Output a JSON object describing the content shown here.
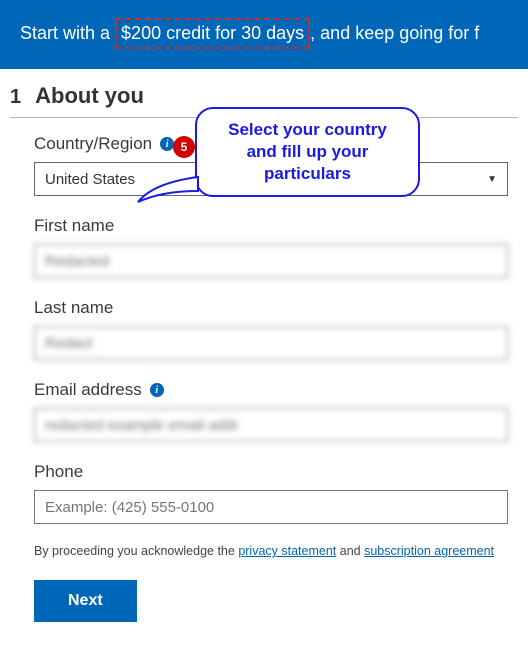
{
  "banner": {
    "prefix": "Start with a ",
    "highlight": "$200 credit for 30 days",
    "suffix": ", and keep going for f"
  },
  "step": {
    "number": "1",
    "title": "About you"
  },
  "annotation": {
    "badge": "5",
    "text": "Select your country and fill up your particulars"
  },
  "form": {
    "country": {
      "label": "Country/Region",
      "value": "United States"
    },
    "first_name": {
      "label": "First name",
      "value": "Redacted"
    },
    "last_name": {
      "label": "Last name",
      "value": "Redact"
    },
    "email": {
      "label": "Email address",
      "value": "redacted example email addr"
    },
    "phone": {
      "label": "Phone",
      "placeholder": "Example: (425) 555-0100"
    }
  },
  "legal": {
    "prefix": "By proceeding you acknowledge the ",
    "link1": "privacy statement",
    "middle": " and ",
    "link2": "subscription agreement"
  },
  "buttons": {
    "next": "Next"
  },
  "icons": {
    "info": "i",
    "caret": "▼"
  }
}
